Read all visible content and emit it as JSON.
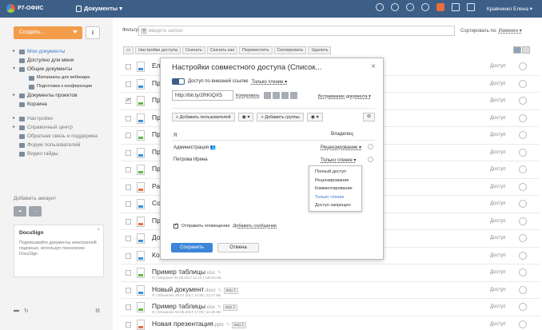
{
  "app": {
    "logo_text": "Р7-ОФИС",
    "module": "Документы ▾",
    "user": "Кравченко Елена ▾"
  },
  "left": {
    "create_label": "Создать...",
    "nav": [
      {
        "label": "Мои документы",
        "indent": 0,
        "arrow": "▸",
        "active": true
      },
      {
        "label": "Доступно для меня",
        "indent": 0,
        "arrow": "",
        "active": false
      },
      {
        "label": "Общие документы",
        "indent": 0,
        "arrow": "▾",
        "active": false
      },
      {
        "label": "Материалы для вебинара",
        "indent": 1,
        "arrow": "",
        "active": false
      },
      {
        "label": "Подготовка к конференции",
        "indent": 1,
        "arrow": "",
        "active": false
      },
      {
        "label": "Документы проектов",
        "indent": 0,
        "arrow": "▸",
        "active": false
      },
      {
        "label": "Корзина",
        "indent": 0,
        "arrow": "",
        "active": false
      }
    ],
    "nav2": [
      {
        "label": "Настройки",
        "arrow": "▸"
      },
      {
        "label": "Справочный центр",
        "arrow": "▸"
      },
      {
        "label": "Обратная связь и поддержка",
        "arrow": ""
      },
      {
        "label": "Форум пользователей",
        "arrow": ""
      },
      {
        "label": "Видео гайды",
        "arrow": ""
      }
    ],
    "add_account": "Добавить аккаунт",
    "acct_more": "...",
    "docusign": {
      "logo": "DocuSign",
      "text": "Подписывайте документы электронной подписью, используя технологию DocuSign",
      "close": "×"
    }
  },
  "filter": {
    "label": "Фильтр",
    "placeholder": "введите запрос",
    "sort_label": "Сортировать по:",
    "sort_value": "Изменен ▾"
  },
  "toolbar": [
    "Настройки доступа",
    "Скачать",
    "Скачать как",
    "Переместить",
    "Скопировать",
    "Удалить"
  ],
  "files": [
    {
      "name": "Ел",
      "ext": "",
      "meta": "",
      "icon": "doc",
      "checked": false
    },
    {
      "name": "Пр",
      "ext": "",
      "meta": "",
      "icon": "doc",
      "checked": false
    },
    {
      "name": "Пр",
      "ext": "",
      "meta": "",
      "icon": "xls",
      "checked": true
    },
    {
      "name": "Пр",
      "ext": "",
      "meta": "",
      "icon": "doc",
      "checked": false
    },
    {
      "name": "Пр",
      "ext": "",
      "meta": "",
      "icon": "xls",
      "checked": false
    },
    {
      "name": "Пр",
      "ext": "",
      "meta": "",
      "icon": "doc",
      "checked": false
    },
    {
      "name": "Пр",
      "ext": "",
      "meta": "",
      "icon": "xls",
      "checked": false
    },
    {
      "name": "Ра",
      "ext": "",
      "meta": "",
      "icon": "ppt",
      "checked": false
    },
    {
      "name": "Со",
      "ext": "",
      "meta": "",
      "icon": "doc",
      "checked": false
    },
    {
      "name": "Пр",
      "ext": "",
      "meta": "",
      "icon": "ppt",
      "checked": false
    },
    {
      "name": "До",
      "ext": "",
      "meta": "",
      "icon": "doc",
      "checked": false
    },
    {
      "name": "Ко",
      "ext": "",
      "meta": "",
      "icon": "doc",
      "checked": false
    },
    {
      "name": "Пример таблицы",
      "ext": ".xlsx",
      "meta": "Я | Загружен 05.08.2017 11:13 | 139,94 КБ",
      "icon": "xls",
      "checked": false,
      "ver": ""
    },
    {
      "name": "Новый документ",
      "ext": ".docx",
      "meta": "Я | Обновлен 28.07.2017 13:35 | 12,47 КБ",
      "icon": "doc",
      "checked": false,
      "ver": "вер.1"
    },
    {
      "name": "Пример таблицы",
      "ext": ".xlsx",
      "meta": "Я | Обновлен 04.05.2017 17:09 | 12,29 КБ",
      "icon": "xls",
      "checked": false,
      "ver": "вер.1"
    },
    {
      "name": "Новая презентация",
      "ext": ".pptx",
      "meta": "",
      "icon": "ppt",
      "checked": false,
      "ver": "вер.1"
    }
  ],
  "access_label": "Доступ",
  "dialog": {
    "title": "Настройки совместного доступа (Список...",
    "toggle_label": "Доступ по внешней ссылке",
    "link_mode": "Только чтение ▾",
    "link_value": "http://bit.ly/2RKIQX5",
    "copy_link": "Копировать",
    "embed": "Встраивание документа ▾",
    "add_users": "+ Добавить пользователей",
    "add_groups": "+ Добавить группы",
    "owner_head": "Владелец",
    "me": "Я",
    "people": [
      {
        "name": "Администрация 👥",
        "rights": "Рецензирование ▾"
      },
      {
        "name": "Петрова Ирина",
        "rights": "Только чтение ▾"
      }
    ],
    "dropdown": [
      {
        "label": "Полный доступ",
        "selected": false
      },
      {
        "label": "Рецензирование",
        "selected": false
      },
      {
        "label": "Комментирование",
        "selected": false
      },
      {
        "label": "Только чтение",
        "selected": true
      },
      {
        "label": "Доступ запрещен",
        "selected": false
      }
    ],
    "notify": "Отправить оповещение",
    "add_message": "Добавить сообщение",
    "save": "Сохранить",
    "cancel": "Отмена"
  },
  "colors": {
    "topbar": "#3d5e87",
    "create": "#f39c4a",
    "save": "#3d86d7",
    "active_link": "#3a7ad0"
  }
}
